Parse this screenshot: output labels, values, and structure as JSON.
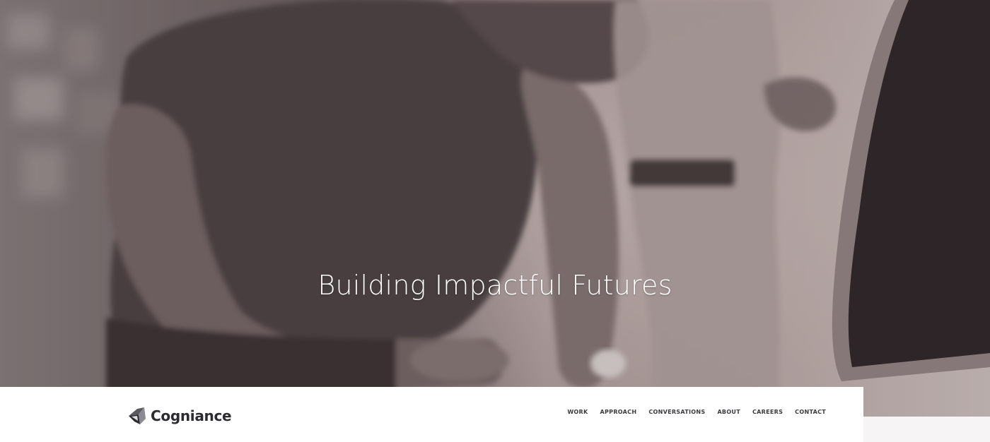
{
  "hero": {
    "title": "Building Impactful Futures"
  },
  "brand": {
    "name": "Cogniance",
    "logo_icon": "cogniance-logo-icon"
  },
  "nav": {
    "items": [
      {
        "label": "WORK"
      },
      {
        "label": "APPROACH"
      },
      {
        "label": "CONVERSATIONS"
      },
      {
        "label": "ABOUT"
      },
      {
        "label": "CAREERS"
      },
      {
        "label": "CONTACT"
      }
    ]
  },
  "colors": {
    "nav_background": "#ffffff",
    "nav_text": "#3a3a3e",
    "hero_text": "#ffffff",
    "hero_tint": "#5a4c4e"
  }
}
